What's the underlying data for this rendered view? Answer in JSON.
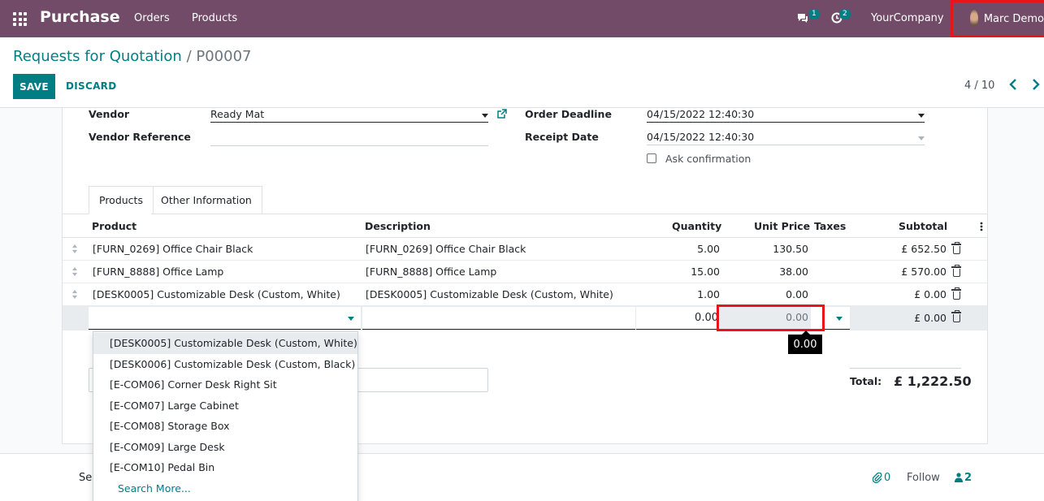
{
  "navbar": {
    "app_name": "Purchase",
    "menu": [
      "Orders",
      "Products"
    ],
    "messages_count": "1",
    "activities_count": "2",
    "company": "YourCompany",
    "user": "Marc Demo"
  },
  "control_panel": {
    "breadcrumb_parent": "Requests for Quotation",
    "breadcrumb_sep": " / ",
    "breadcrumb_current": "P00007",
    "save_label": "SAVE",
    "discard_label": "DISCARD",
    "pager": "4 / 10"
  },
  "form": {
    "vendor_label": "Vendor",
    "vendor_value": "Ready Mat",
    "vendor_ref_label": "Vendor Reference",
    "vendor_ref_value": "",
    "order_deadline_label": "Order Deadline",
    "order_deadline_value": "04/15/2022 12:40:30",
    "receipt_date_label": "Receipt Date",
    "receipt_date_value": "04/15/2022 12:40:30",
    "ask_confirmation_label": "Ask confirmation"
  },
  "tabs": [
    "Products",
    "Other Information"
  ],
  "table": {
    "headers": {
      "product": "Product",
      "description": "Description",
      "quantity": "Quantity",
      "unit_price": "Unit Price",
      "taxes": "Taxes",
      "subtotal": "Subtotal"
    },
    "rows": [
      {
        "product": "[FURN_0269] Office Chair Black",
        "description": "[FURN_0269] Office Chair Black",
        "quantity": "5.00",
        "unit_price": "130.50",
        "subtotal": "£ 652.50"
      },
      {
        "product": "[FURN_8888] Office Lamp",
        "description": "[FURN_8888] Office Lamp",
        "quantity": "15.00",
        "unit_price": "38.00",
        "subtotal": "£ 570.00"
      },
      {
        "product": "[DESK0005] Customizable Desk (Custom, White)",
        "description": "[DESK0005] Customizable Desk (Custom, White)",
        "quantity": "1.00",
        "unit_price": "0.00",
        "subtotal": "£ 0.00"
      }
    ],
    "edit_row": {
      "quantity": "0.00",
      "unit_price": "0.00",
      "subtotal": "£ 0.00"
    }
  },
  "tooltip": "0.00",
  "dropdown": {
    "items": [
      "[DESK0005] Customizable Desk (Custom, White)",
      "[DESK0006] Customizable Desk (Custom, Black)",
      "[E-COM06] Corner Desk Right Sit",
      "[E-COM07] Large Cabinet",
      "[E-COM08] Storage Box",
      "[E-COM09] Large Desk",
      "[E-COM10] Pedal Bin"
    ],
    "search_more": "Search More..."
  },
  "totals": {
    "label": "Total:",
    "value": "£ 1,222.50"
  },
  "chatter": {
    "send_partial": "Se",
    "attachments": "0",
    "follow": "Follow",
    "followers": "2"
  },
  "colors": {
    "brand": "#714b67",
    "accent": "#017e84",
    "highlight": "#e8141b"
  }
}
